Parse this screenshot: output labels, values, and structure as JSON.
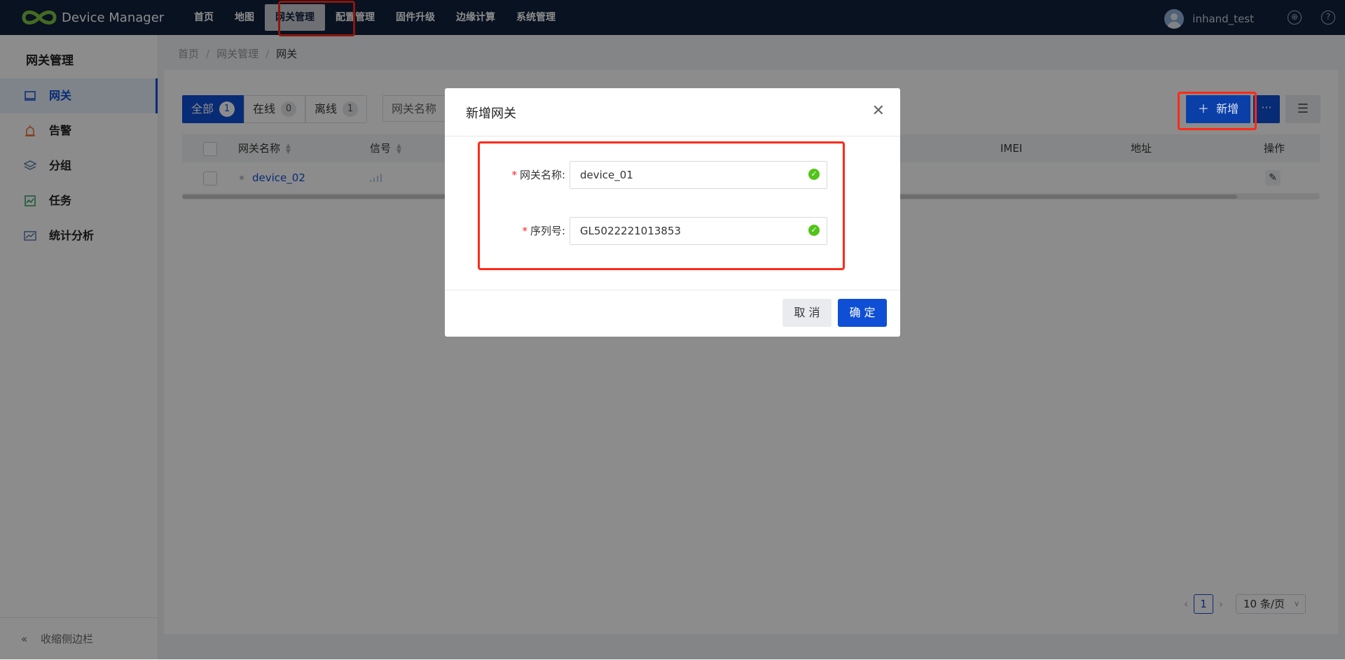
{
  "app": {
    "brand": "Device Manager"
  },
  "nav": {
    "items": [
      {
        "label": "首页"
      },
      {
        "label": "地图"
      },
      {
        "label": "网关管理"
      },
      {
        "label": "配置管理"
      },
      {
        "label": "固件升级"
      },
      {
        "label": "边缘计算"
      },
      {
        "label": "系统管理"
      }
    ],
    "active_index": 2
  },
  "user": {
    "name": "inhand_test"
  },
  "sidebar": {
    "title": "网关管理",
    "items": [
      {
        "label": "网关",
        "icon": "gateway-icon"
      },
      {
        "label": "告警",
        "icon": "alarm-icon"
      },
      {
        "label": "分组",
        "icon": "layers-icon"
      },
      {
        "label": "任务",
        "icon": "task-icon"
      },
      {
        "label": "统计分析",
        "icon": "stats-icon"
      }
    ],
    "collapse_label": "收缩侧边栏"
  },
  "breadcrumb": [
    "首页",
    "网关管理",
    "网关"
  ],
  "filters": {
    "segments": [
      {
        "label": "全部",
        "count": "1"
      },
      {
        "label": "在线",
        "count": "0"
      },
      {
        "label": "离线",
        "count": "1"
      }
    ],
    "search_field": "网关名称"
  },
  "toolbar": {
    "add_label": "新增",
    "more_label": "···"
  },
  "table": {
    "columns": [
      "网关名称",
      "信号",
      "IMEI",
      "地址",
      "操作"
    ],
    "rows": [
      {
        "name": "device_02"
      }
    ]
  },
  "pagination": {
    "current_page": "1",
    "page_size": "10 条/页"
  },
  "modal": {
    "title": "新增网关",
    "fields": [
      {
        "label": "网关名称:",
        "value": "device_01"
      },
      {
        "label": "序列号:",
        "value": "GL5022221013853"
      }
    ],
    "cancel_label": "取 消",
    "ok_label": "确 定"
  },
  "colors": {
    "primary": "#0f4fd6",
    "topbar": "#10213c",
    "highlight": "#ff2a1a",
    "success": "#52c41a"
  }
}
